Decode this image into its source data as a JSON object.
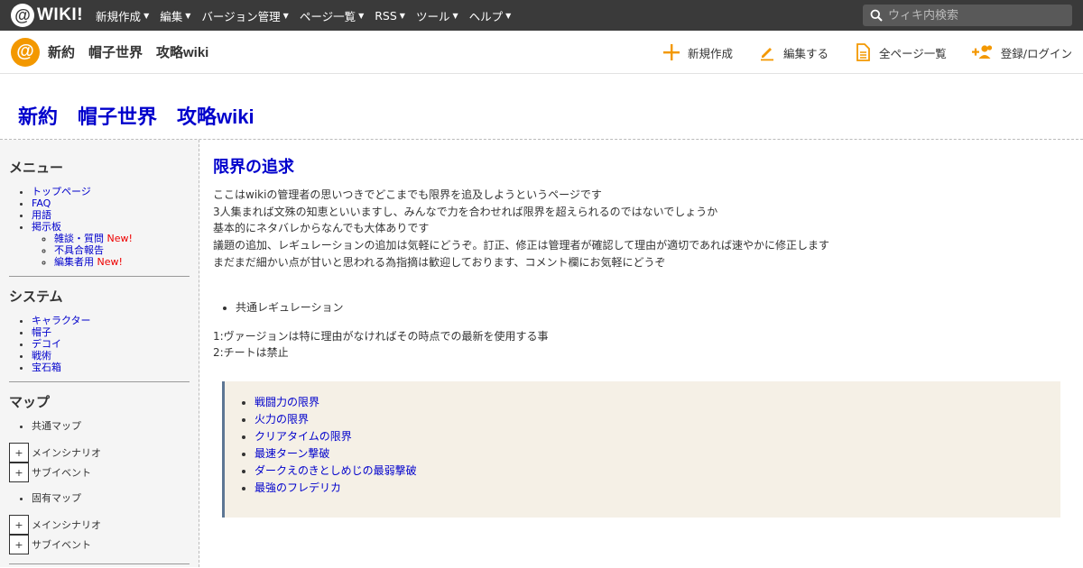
{
  "topbar": {
    "logo_mark": "@",
    "logo_text": "WIKI!",
    "nav": [
      "新規作成",
      "編集",
      "バージョン管理",
      "ページ一覧",
      "RSS",
      "ツール",
      "ヘルプ"
    ],
    "search_placeholder": "ウィキ内検索"
  },
  "subbar": {
    "logo_mark": "@",
    "site_name": "新約　帽子世界　攻略wiki",
    "actions": [
      "新規作成",
      "編集する",
      "全ページ一覧",
      "登録/ログイン"
    ]
  },
  "wiki_title": "新約　帽子世界　攻略wiki",
  "sidebar": {
    "menu_heading": "メニュー",
    "menu_items": [
      "トップページ",
      "FAQ",
      "用語",
      "掲示板"
    ],
    "board_items": [
      {
        "label": "雑談・質問",
        "badge": "New!"
      },
      {
        "label": "不具合報告",
        "badge": ""
      },
      {
        "label": "編集者用",
        "badge": "New!"
      }
    ],
    "system_heading": "システム",
    "system_items": [
      "キャラクター",
      "帽子",
      "デコイ",
      "戦術",
      "宝石箱"
    ],
    "map_heading": "マップ",
    "common_map": "共通マップ",
    "unique_map": "固有マップ",
    "toggle_symbol": "+",
    "main_scenario": "メインシナリオ",
    "sub_event": "サブイベント"
  },
  "main": {
    "heading": "限界の追求",
    "intro": [
      "ここはwikiの管理者の思いつきでどこまでも限界を追及しようというページです",
      "3人集まれば文殊の知恵といいますし、みんなで力を合わせれば限界を超えられるのではないでしょうか",
      "基本的にネタバレからなんでも大体ありです",
      "議題の追加、レギュレーションの追加は気軽にどうぞ。訂正、修正は管理者が確認して理由が適切であれば速やかに修正します",
      "まだまだ細かい点が甘いと思われる為指摘は歓迎しております、コメント欄にお気軽にどうぞ"
    ],
    "regulation_bullet": "共通レギュレーション",
    "rules": [
      "1:ヴァージョンは特に理由がなければその時点での最新を使用する事",
      "2:チートは禁止"
    ],
    "links": [
      "戦闘力の限界",
      "火力の限界",
      "クリアタイムの限界",
      "最速ターン撃破",
      "ダークえのきとしめじの最弱撃破",
      "最強のフレデリカ"
    ]
  },
  "colors": {
    "topbar_bg": "#3a3a3a",
    "accent_orange": "#f39800",
    "link_blue": "#0000cc",
    "new_red": "#e00000",
    "box_bg": "#f5f0e6",
    "box_border": "#5d7694"
  }
}
